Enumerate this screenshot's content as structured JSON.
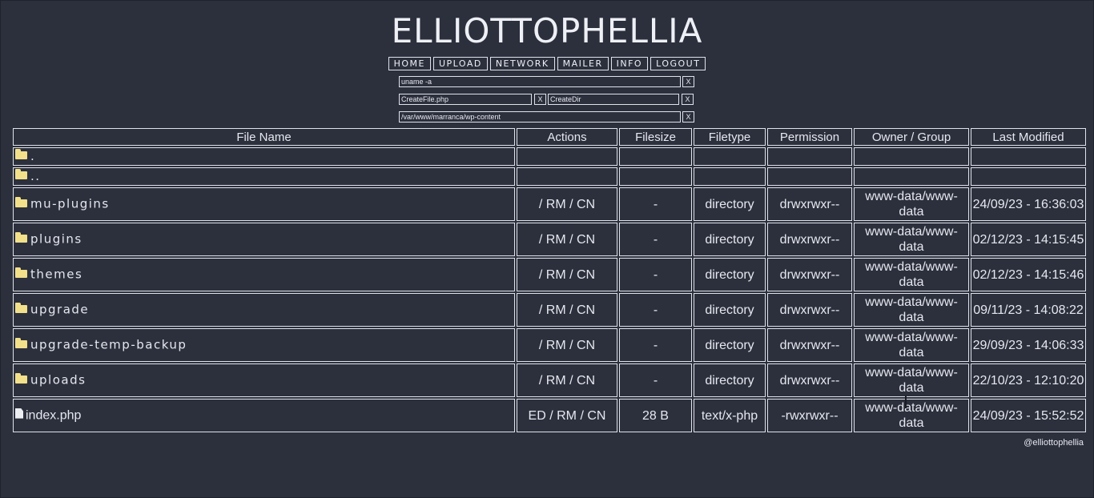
{
  "title": "ELLIOTTOPHELLIA",
  "nav": [
    "HOME",
    "UPLOAD",
    "NETWORK",
    "MAILER",
    "INFO",
    "LOGOUT"
  ],
  "command": {
    "value": "uname -a",
    "button": "X"
  },
  "create_file": {
    "value": "CreateFile.php",
    "button": "X"
  },
  "create_dir": {
    "value": "CreateDir",
    "button": "X"
  },
  "path": {
    "value": "/var/www/marranca/wp-content",
    "button": "X"
  },
  "table": {
    "headers": [
      "File Name",
      "Actions",
      "Filesize",
      "Filetype",
      "Permission",
      "Owner / Group",
      "Last Modified"
    ],
    "rows": [
      {
        "name": ".",
        "type": "dir",
        "actions": "",
        "size": "",
        "filetype": "",
        "perm": "",
        "owner": "",
        "modified": ""
      },
      {
        "name": "..",
        "type": "dir",
        "actions": "",
        "size": "",
        "filetype": "",
        "perm": "",
        "owner": "",
        "modified": ""
      },
      {
        "name": "mu-plugins",
        "type": "dir",
        "actions": "/ RM / CN",
        "size": "-",
        "filetype": "directory",
        "perm": "drwxrwxr--",
        "owner": "www-data/www-data",
        "modified": "24/09/23 - 16:36:03"
      },
      {
        "name": "plugins",
        "type": "dir",
        "actions": "/ RM / CN",
        "size": "-",
        "filetype": "directory",
        "perm": "drwxrwxr--",
        "owner": "www-data/www-data",
        "modified": "02/12/23 - 14:15:45"
      },
      {
        "name": "themes",
        "type": "dir",
        "actions": "/ RM / CN",
        "size": "-",
        "filetype": "directory",
        "perm": "drwxrwxr--",
        "owner": "www-data/www-data",
        "modified": "02/12/23 - 14:15:46"
      },
      {
        "name": "upgrade",
        "type": "dir",
        "actions": "/ RM / CN",
        "size": "-",
        "filetype": "directory",
        "perm": "drwxrwxr--",
        "owner": "www-data/www-data",
        "modified": "09/11/23 - 14:08:22"
      },
      {
        "name": "upgrade-temp-backup",
        "type": "dir",
        "actions": "/ RM / CN",
        "size": "-",
        "filetype": "directory",
        "perm": "drwxrwxr--",
        "owner": "www-data/www-data",
        "modified": "29/09/23 - 14:06:33"
      },
      {
        "name": "uploads",
        "type": "dir",
        "actions": "/ RM / CN",
        "size": "-",
        "filetype": "directory",
        "perm": "drwxrwxr--",
        "owner": "www-data/www-data",
        "modified": "22/10/23 - 12:10:20"
      },
      {
        "name": "index.php",
        "type": "file",
        "actions": "ED / RM / CN",
        "size": "28 B",
        "filetype": "text/x-php",
        "perm": "-rwxrwxr--",
        "owner": "www-data/www-data",
        "modified": "24/09/23 - 15:52:52"
      }
    ]
  },
  "footer": "@elliottophellia",
  "colors": {
    "background": "#2c303d",
    "text": "#e6e8ee",
    "folder": "#f2e08a"
  }
}
